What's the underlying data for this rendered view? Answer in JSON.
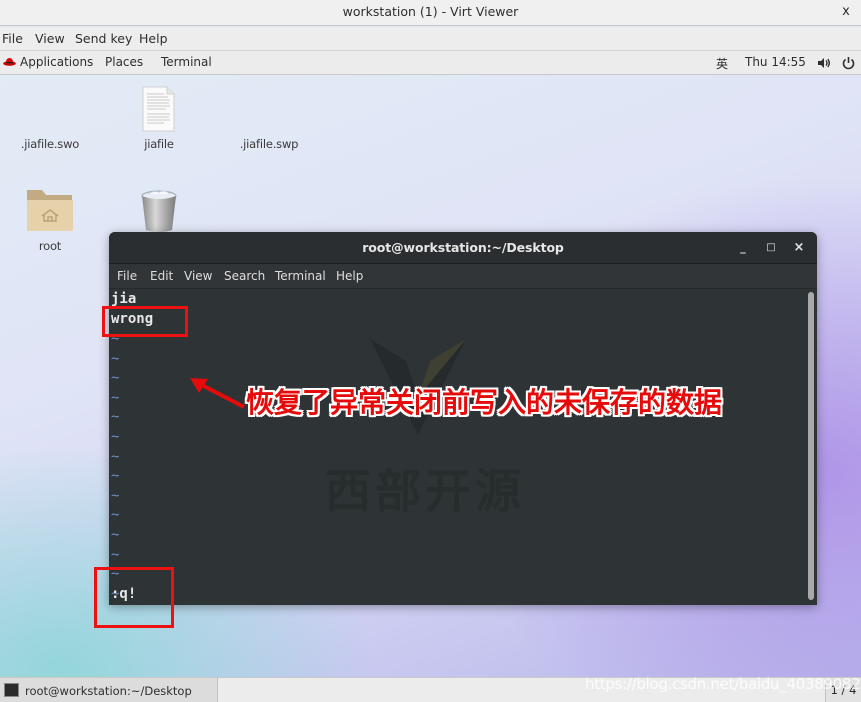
{
  "window": {
    "title": "workstation (1) - Virt Viewer",
    "close_label": "x"
  },
  "viewer_menu": [
    "File",
    "View",
    "Send key",
    "Help"
  ],
  "gnome_bar": {
    "left": [
      "Applications",
      "Places",
      "Terminal"
    ],
    "input_method": "英",
    "clock": "Thu 14:55",
    "volume_icon": "volume-icon",
    "power_icon": "power-icon"
  },
  "desktop_icons": [
    {
      "label": ".jiafile.swo",
      "icon": "none"
    },
    {
      "label": "jiafile",
      "icon": "text-document-icon"
    },
    {
      "label": ".jiafile.swp",
      "icon": "none"
    },
    {
      "label": "root",
      "icon": "home-folder-icon"
    },
    {
      "label": "",
      "icon": "trash-icon"
    }
  ],
  "terminal": {
    "title": "root@workstation:~/Desktop",
    "buttons": {
      "minimize": "_",
      "maximize": "□",
      "close": "×"
    },
    "menu": [
      "File",
      "Edit",
      "View",
      "Search",
      "Terminal",
      "Help"
    ],
    "lines": [
      "jia",
      "wrong"
    ],
    "tilde_count": 14,
    "tilde_char": "~",
    "command_line": ":q!"
  },
  "watermark": {
    "text": "西部开源"
  },
  "annotation": {
    "text": "恢复了异常关闭前写入的未保存的数据",
    "color": "#e50b0b"
  },
  "taskbar": {
    "task_label": "root@workstation:~/Desktop",
    "workspace": "1 / 4"
  },
  "url_watermark": "https://blog.csdn.net/baidu_40389082"
}
